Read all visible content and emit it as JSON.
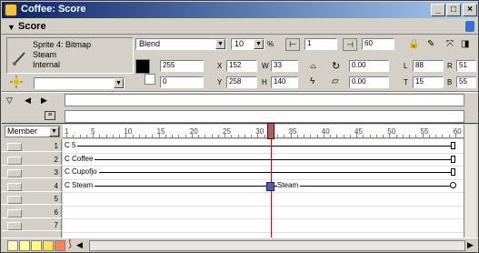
{
  "window": {
    "title": "Coffee: Score"
  },
  "score": {
    "label": "Score"
  },
  "sprite_info": {
    "line1": "Sprite 4: Bitmap",
    "line2": "Steam",
    "line3": "Internal",
    "cast_dropdown": ""
  },
  "props": {
    "ink": "Blend",
    "blend": "10",
    "blend_unit": "%",
    "start_frame": "1",
    "end_frame": "60",
    "color_fg": "255",
    "color_bg": "0",
    "x_label": "X",
    "x": "152",
    "y_label": "Y",
    "y": "258",
    "w_label": "W",
    "w": "33",
    "h_label": "H",
    "h": "140",
    "rotation": "0.00",
    "skew": "0.00",
    "l_label": "L",
    "l": "88",
    "t_label": "T",
    "t": "15",
    "r_label": "R",
    "r": "51",
    "b_label": "B",
    "b": "55"
  },
  "frames": {
    "member_dropdown": "Member",
    "ticks": [
      "1",
      "5",
      "10",
      "15",
      "20",
      "25",
      "30",
      "35",
      "40",
      "45",
      "50",
      "55",
      "60"
    ],
    "current_frame": 32
  },
  "channels": [
    {
      "num": "1",
      "sprite": "C 5"
    },
    {
      "num": "2",
      "sprite": "C Coffee"
    },
    {
      "num": "3",
      "sprite": "C Cupofjo"
    },
    {
      "num": "4",
      "sprite": "C Steam",
      "sprite2": "Steam"
    },
    {
      "num": "5",
      "sprite": ""
    },
    {
      "num": "6",
      "sprite": ""
    },
    {
      "num": "7",
      "sprite": ""
    }
  ],
  "colors": {
    "title_start": "#0a246a",
    "title_end": "#a6caf0",
    "playhead": "#e00000",
    "keyframe": "#5060b0"
  }
}
